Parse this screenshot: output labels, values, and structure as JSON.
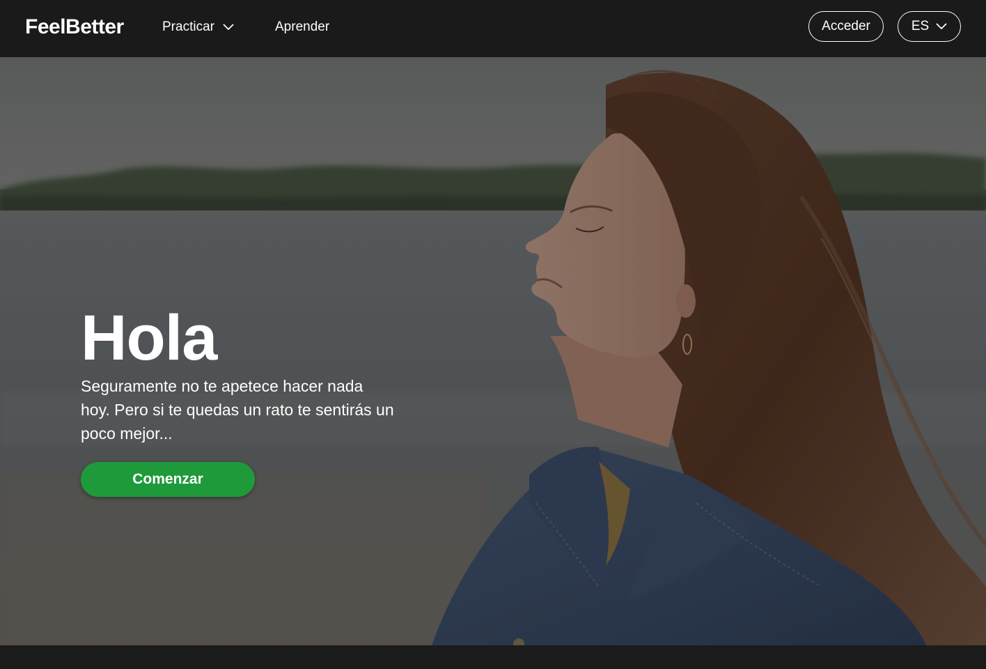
{
  "nav": {
    "logo": "FeelBetter",
    "practicar_label": "Practicar",
    "aprender_label": "Aprender",
    "login_label": "Acceder",
    "language_label": "ES"
  },
  "hero": {
    "title": "Hola",
    "subtitle": "Seguramente no te apetece hacer nada hoy. Pero si te quedas un rato te sentirás un poco mejor...",
    "cta_label": "Comenzar"
  },
  "colors": {
    "navbar_bg": "#1a1a1a",
    "accent_green": "#1e9a3a",
    "text": "#ffffff"
  },
  "icons": {
    "practicar_chevron": "chevron-down-icon",
    "language_chevron": "chevron-down-icon"
  }
}
